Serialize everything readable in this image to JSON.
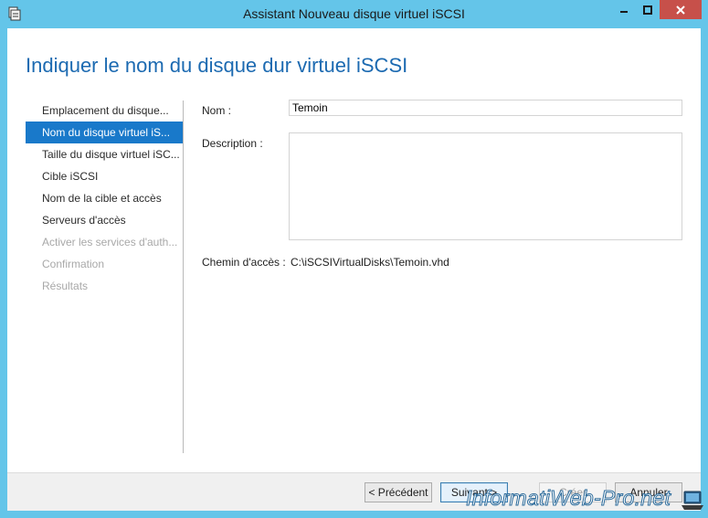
{
  "window": {
    "title": "Assistant Nouveau disque virtuel iSCSI"
  },
  "page": {
    "heading": "Indiquer le nom du disque dur virtuel iSCSI"
  },
  "nav": {
    "items": [
      {
        "label": "Emplacement du disque...",
        "state": "normal"
      },
      {
        "label": "Nom du disque virtuel iS...",
        "state": "active"
      },
      {
        "label": "Taille du disque virtuel iSC...",
        "state": "normal"
      },
      {
        "label": "Cible iSCSI",
        "state": "normal"
      },
      {
        "label": "Nom de la cible et accès",
        "state": "normal"
      },
      {
        "label": "Serveurs d'accès",
        "state": "normal"
      },
      {
        "label": "Activer les services d'auth...",
        "state": "disabled"
      },
      {
        "label": "Confirmation",
        "state": "disabled"
      },
      {
        "label": "Résultats",
        "state": "disabled"
      }
    ]
  },
  "form": {
    "name_label": "Nom :",
    "name_value": "Temoin",
    "description_label": "Description :",
    "description_value": "",
    "path_label": "Chemin d'accès :",
    "path_value": "C:\\iSCSIVirtualDisks\\Temoin.vhd"
  },
  "buttons": {
    "previous": "< Précédent",
    "next": "Suivant >",
    "create": "Créer",
    "cancel": "Annuler"
  },
  "watermark": {
    "text": "InformatiWeb-Pro.net"
  },
  "colors": {
    "titlebar": "#64c5e9",
    "close_button": "#c7504a",
    "heading": "#1c6ab1",
    "nav_active": "#1979ca"
  }
}
